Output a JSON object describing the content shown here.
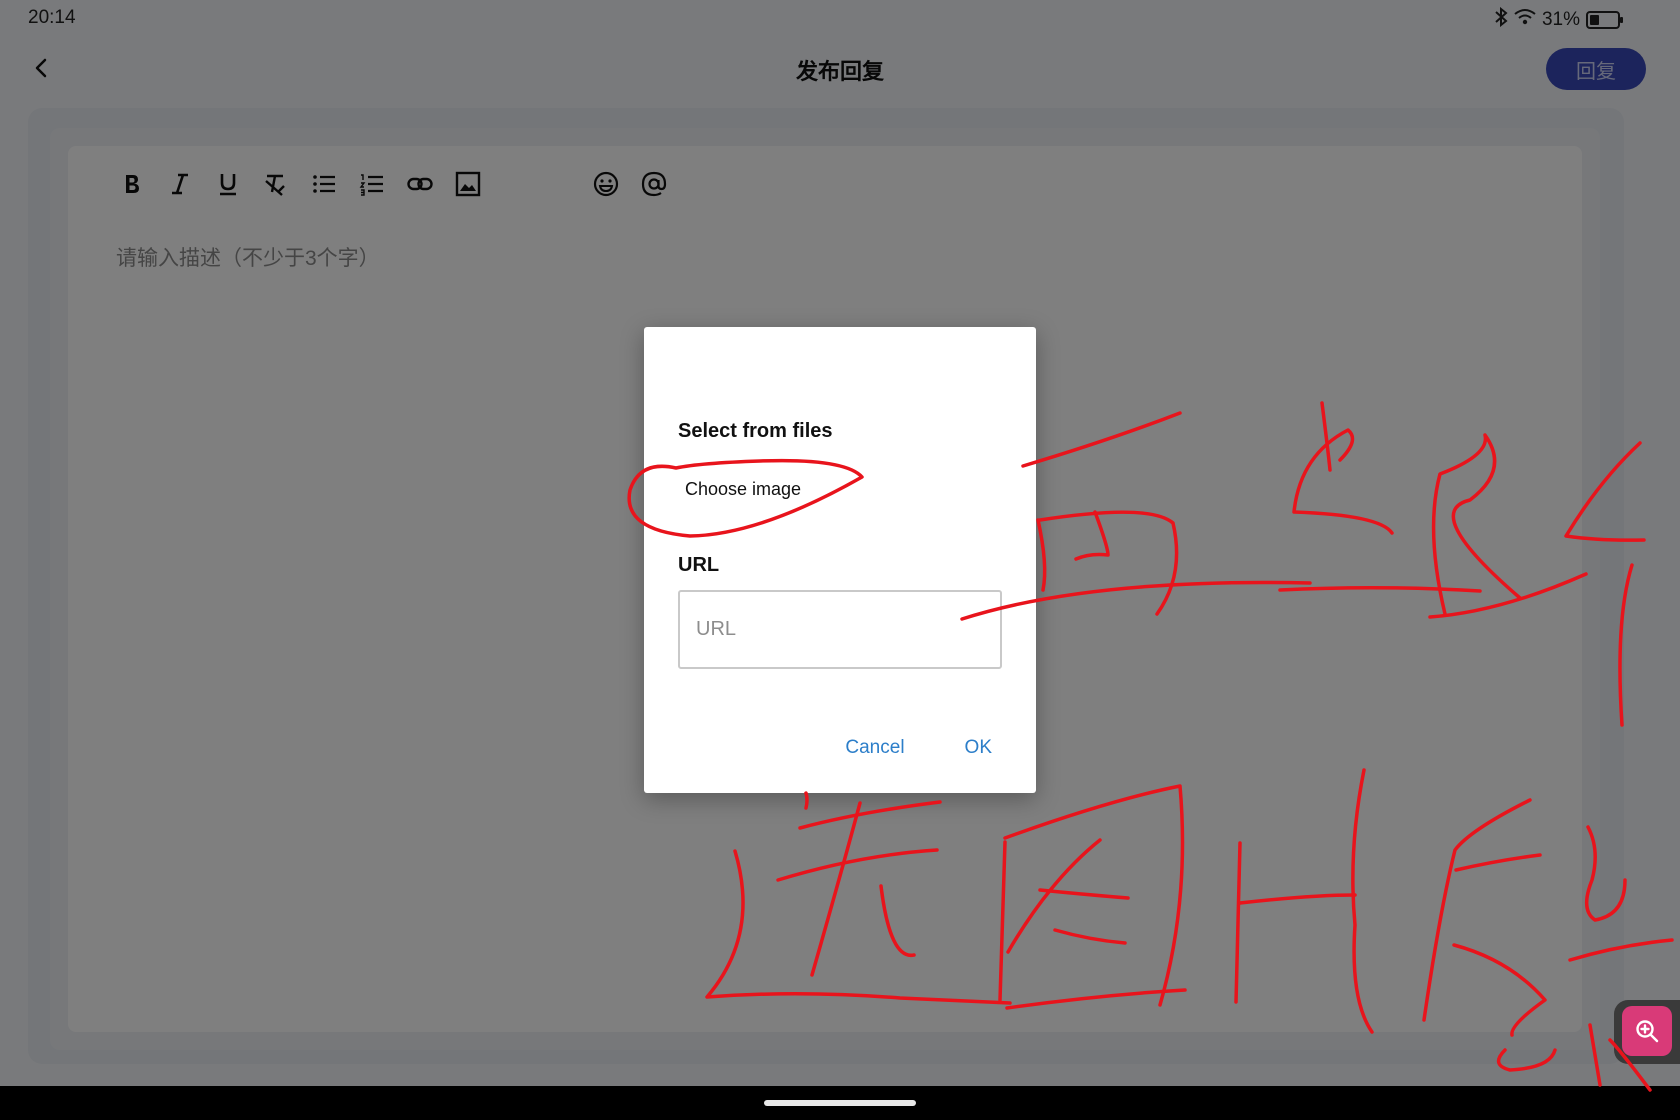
{
  "status_bar": {
    "time": "20:14",
    "battery_text": "31%",
    "icons": [
      "bluetooth-icon",
      "wifi-icon",
      "battery-icon"
    ]
  },
  "header": {
    "title": "发布回复",
    "reply_button": "回复",
    "back_icon": "chevron-left-icon"
  },
  "toolbar": {
    "tools": [
      "bold",
      "italic",
      "underline",
      "clear-format",
      "bullet-list",
      "numbered-list",
      "link",
      "image",
      "emoji",
      "mention"
    ]
  },
  "editor": {
    "placeholder": "请输入描述（不少于3个字）"
  },
  "dialog": {
    "file_section_label": "Select from files",
    "choose_image": "Choose image",
    "url_section_label": "URL",
    "url_placeholder": "URL",
    "url_value": "",
    "cancel": "Cancel",
    "ok": "OK"
  },
  "colors": {
    "reply_button_bg": "#3948b8",
    "dialog_action": "#2c7ec9",
    "annotation": "#e8141c",
    "zoom_button": "#d93a78"
  }
}
